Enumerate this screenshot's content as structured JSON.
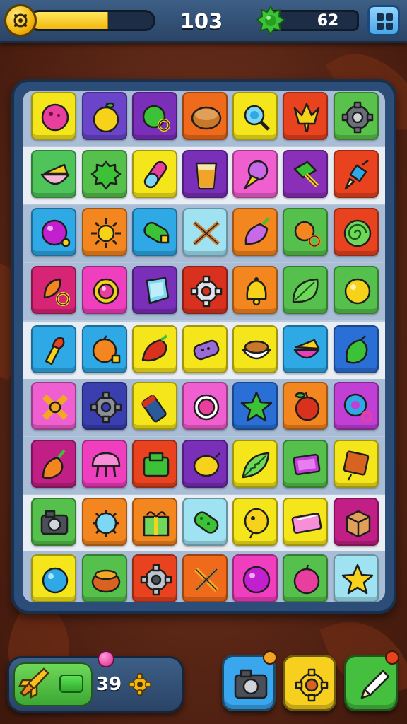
{
  "top_bar": {
    "score": "103",
    "gem_count": "62",
    "progress": 0.62,
    "icons": {
      "coin": "coin-icon",
      "gem": "green-gem-icon",
      "menu": "grid-menu-icon"
    }
  },
  "board": {
    "rows": [
      {
        "band": "#a9bdd6",
        "tiles": [
          {
            "bg": "#f5e51b",
            "icon": "pink-blob"
          },
          {
            "bg": "#6a45c9",
            "icon": "yellow-apple"
          },
          {
            "bg": "#7a2fb8",
            "icon": "green-apple-ring"
          },
          {
            "bg": "#f06a1c",
            "icon": "bread-bowl"
          },
          {
            "bg": "#f5e51b",
            "icon": "blue-lollipop"
          },
          {
            "bg": "#e8421f",
            "icon": "yellow-crown"
          },
          {
            "bg": "#59c24a",
            "icon": "gear-cog"
          }
        ]
      },
      {
        "band": "#e9eef5",
        "tiles": [
          {
            "bg": "#4ec45a",
            "icon": "cheese-bowl"
          },
          {
            "bg": "#55c04b",
            "icon": "green-bush"
          },
          {
            "bg": "#f5e51b",
            "icon": "pink-pill"
          },
          {
            "bg": "#7a2fb8",
            "icon": "juice-glass"
          },
          {
            "bg": "#ef5fd0",
            "icon": "ice-cream"
          },
          {
            "bg": "#8a2fb8",
            "icon": "green-hammer"
          },
          {
            "bg": "#e8421f",
            "icon": "paint-brush"
          }
        ]
      },
      {
        "band": "#a9bdd6",
        "tiles": [
          {
            "bg": "#2fa8e6",
            "icon": "purple-ball"
          },
          {
            "bg": "#f3861f",
            "icon": "yellow-sun"
          },
          {
            "bg": "#2fa8e6",
            "icon": "green-cucumber"
          },
          {
            "bg": "#9fe3f3",
            "icon": "crossed-sticks"
          },
          {
            "bg": "#f3861f",
            "icon": "purple-radish"
          },
          {
            "bg": "#55c04b",
            "icon": "orange-ring"
          },
          {
            "bg": "#e8421f",
            "icon": "green-spiral"
          }
        ]
      },
      {
        "band": "#a9bdd6",
        "tiles": [
          {
            "bg": "#d82474",
            "icon": "orange-leaf-ring"
          },
          {
            "bg": "#ef3fbf",
            "icon": "pink-ring"
          },
          {
            "bg": "#7a2fb8",
            "icon": "blue-gem"
          },
          {
            "bg": "#d8321f",
            "icon": "white-gear"
          },
          {
            "bg": "#f3861f",
            "icon": "yellow-bell"
          },
          {
            "bg": "#55c04b",
            "icon": "green-leaf"
          },
          {
            "bg": "#55c04b",
            "icon": "yellow-ball"
          }
        ]
      },
      {
        "band": "#e9eef5",
        "tiles": [
          {
            "bg": "#2fa8e6",
            "icon": "torch"
          },
          {
            "bg": "#2fa8e6",
            "icon": "orange-fruit"
          },
          {
            "bg": "#f5e51b",
            "icon": "red-pepper"
          },
          {
            "bg": "#f5e51b",
            "icon": "purple-phone"
          },
          {
            "bg": "#f5e51b",
            "icon": "pie-bowl"
          },
          {
            "bg": "#2fa8e6",
            "icon": "cake-slice"
          },
          {
            "bg": "#2a6fd6",
            "icon": "green-lime"
          }
        ]
      },
      {
        "band": "#a9bdd6",
        "tiles": [
          {
            "bg": "#ef5fd0",
            "icon": "orange-cross"
          },
          {
            "bg": "#3a3fb0",
            "icon": "grey-gear"
          },
          {
            "bg": "#f5e51b",
            "icon": "blue-battery"
          },
          {
            "bg": "#ef5fd0",
            "icon": "pink-button"
          },
          {
            "bg": "#2a6fd6",
            "icon": "green-star"
          },
          {
            "bg": "#f3861f",
            "icon": "red-apple"
          },
          {
            "bg": "#c23fd6",
            "icon": "blue-donut"
          }
        ]
      },
      {
        "band": "#a9bdd6",
        "tiles": [
          {
            "bg": "#c21f86",
            "icon": "orange-radish"
          },
          {
            "bg": "#ef3fbf",
            "icon": "pink-mushroom"
          },
          {
            "bg": "#e8421f",
            "icon": "green-box"
          },
          {
            "bg": "#7a2fb8",
            "icon": "yellow-lemon"
          },
          {
            "bg": "#f5e51b",
            "icon": "green-leaf-fan"
          },
          {
            "bg": "#55c04b",
            "icon": "purple-tv"
          },
          {
            "bg": "#f5e51b",
            "icon": "red-sign"
          }
        ]
      },
      {
        "band": "#e9eef5",
        "tiles": [
          {
            "bg": "#55c04b",
            "icon": "camera"
          },
          {
            "bg": "#f3861f",
            "icon": "blue-virus"
          },
          {
            "bg": "#f3861f",
            "icon": "green-gift"
          },
          {
            "bg": "#9fe3f3",
            "icon": "green-cucumber-2"
          },
          {
            "bg": "#f5e51b",
            "icon": "yellow-balloon"
          },
          {
            "bg": "#f5e51b",
            "icon": "pink-book"
          },
          {
            "bg": "#c21f86",
            "icon": "orange-crate"
          }
        ]
      },
      {
        "band": "#a9bdd6",
        "tiles": [
          {
            "bg": "#f5e51b",
            "icon": "blue-ball"
          },
          {
            "bg": "#55c04b",
            "icon": "orange-pot"
          },
          {
            "bg": "#e8421f",
            "icon": "silver-gear"
          },
          {
            "bg": "#f06a1c",
            "icon": "crossed-pens"
          },
          {
            "bg": "#ef3fbf",
            "icon": "purple-ball-2"
          },
          {
            "bg": "#55c04b",
            "icon": "pink-apple"
          },
          {
            "bg": "#9fe3f3",
            "icon": "yellow-star"
          }
        ]
      }
    ]
  },
  "bottom_bar": {
    "power_count": "39",
    "icons": {
      "rocket": "rocket-icon",
      "battery": "battery-icon",
      "gear": "gear-icon"
    },
    "buttons": [
      {
        "name": "camera-button",
        "bg": "#3aa6ee",
        "badge": "#f4a323"
      },
      {
        "name": "settings-button",
        "bg": "#f7cf1f",
        "badge": ""
      },
      {
        "name": "pencil-button",
        "bg": "#44bf3e",
        "badge": "#e8421f"
      }
    ]
  }
}
